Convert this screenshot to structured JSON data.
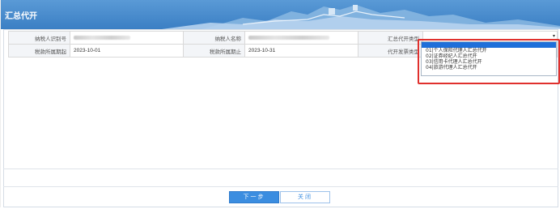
{
  "header": {
    "title": "汇总代开"
  },
  "form": {
    "taxpayer_id_label": "纳税人识别号",
    "taxpayer_name_label": "纳税人名称",
    "summary_type_label": "汇总代开类型",
    "period_start_label": "税款所属期起",
    "period_start_value": "2023-10-01",
    "period_end_label": "税款所属期止",
    "period_end_value": "2023-10-31",
    "invoice_type_label": "代开发票类型"
  },
  "dropdown": {
    "options": [
      "",
      "01|个人保险代理人汇总代开",
      "02|证券经纪人汇总代开",
      "03|信用卡代理人汇总代开",
      "04|旅游代理人汇总代开"
    ]
  },
  "buttons": {
    "next": "下一步",
    "close": "关闭"
  },
  "colors": {
    "header_blue": "#3b7fc4",
    "highlight_red": "#e0302d",
    "selected_blue": "#1e6fd9"
  }
}
